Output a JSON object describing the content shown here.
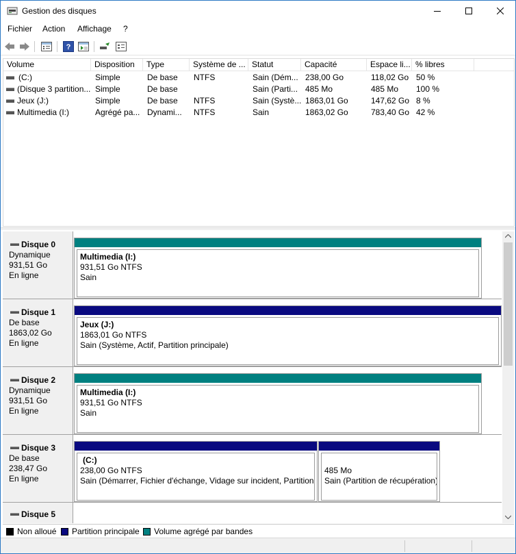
{
  "window": {
    "title": "Gestion des disques"
  },
  "menu": [
    {
      "label": "Fichier"
    },
    {
      "label": "Action"
    },
    {
      "label": "Affichage"
    },
    {
      "label": "?"
    }
  ],
  "toolbar": {
    "icons": [
      "back-icon",
      "forward-icon",
      "properties-view-icon",
      "help-icon",
      "console-view-icon",
      "disk-connect-icon",
      "settings-list-icon"
    ]
  },
  "volume_list": {
    "columns": [
      "Volume",
      "Disposition",
      "Type",
      "Système de ...",
      "Statut",
      "Capacité",
      "Espace li...",
      "% libres"
    ],
    "rows": [
      [
        "(C:)",
        "Simple",
        "De base",
        "NTFS",
        "Sain (Dém...",
        "238,00 Go",
        "118,02 Go",
        "50 %"
      ],
      [
        "(Disque 3 partition...",
        "Simple",
        "De base",
        "",
        "Sain (Parti...",
        "485 Mo",
        "485 Mo",
        "100 %"
      ],
      [
        "Jeux (J:)",
        "Simple",
        "De base",
        "NTFS",
        "Sain (Systè...",
        "1863,01 Go",
        "147,62 Go",
        "8 %"
      ],
      [
        "Multimedia (I:)",
        "Agrégé pa...",
        "Dynami...",
        "NTFS",
        "Sain",
        "1863,02 Go",
        "783,40 Go",
        "42 %"
      ]
    ]
  },
  "disks": [
    {
      "name": "Disque 0",
      "type": "Dynamique",
      "size": "931,51 Go",
      "state": "En ligne",
      "partitions": [
        {
          "title": "Multimedia  (I:)",
          "detail": "931,51 Go NTFS",
          "status": "Sain",
          "color": "#008080"
        }
      ]
    },
    {
      "name": "Disque 1",
      "type": "De base",
      "size": "1863,02 Go",
      "state": "En ligne",
      "partitions": [
        {
          "title": "Jeux  (J:)",
          "detail": "1863,01 Go NTFS",
          "status": "Sain (Système, Actif, Partition principale)",
          "color": "#0a0a80"
        }
      ]
    },
    {
      "name": "Disque 2",
      "type": "Dynamique",
      "size": "931,51 Go",
      "state": "En ligne",
      "partitions": [
        {
          "title": "Multimedia  (I:)",
          "detail": "931,51 Go NTFS",
          "status": "Sain",
          "color": "#008080"
        }
      ]
    },
    {
      "name": "Disque 3",
      "type": "De base",
      "size": "238,47 Go",
      "state": "En ligne",
      "partitions": [
        {
          "title": "(C:)",
          "detail": "238,00 Go NTFS",
          "status": "Sain (Démarrer, Fichier d'échange, Vidage sur incident, Partition principale)",
          "color": "#0a0a80"
        },
        {
          "title": "",
          "detail": "485 Mo",
          "status": "Sain (Partition de récupération)",
          "color": "#0a0a80"
        }
      ]
    },
    {
      "name": "Disque 5",
      "type": "",
      "size": "",
      "state": "",
      "partitions": []
    }
  ],
  "legend": [
    {
      "label": "Non alloué",
      "color": "#000000"
    },
    {
      "label": "Partition principale",
      "color": "#0a0a80"
    },
    {
      "label": "Volume agrégé par bandes",
      "color": "#008080"
    }
  ]
}
